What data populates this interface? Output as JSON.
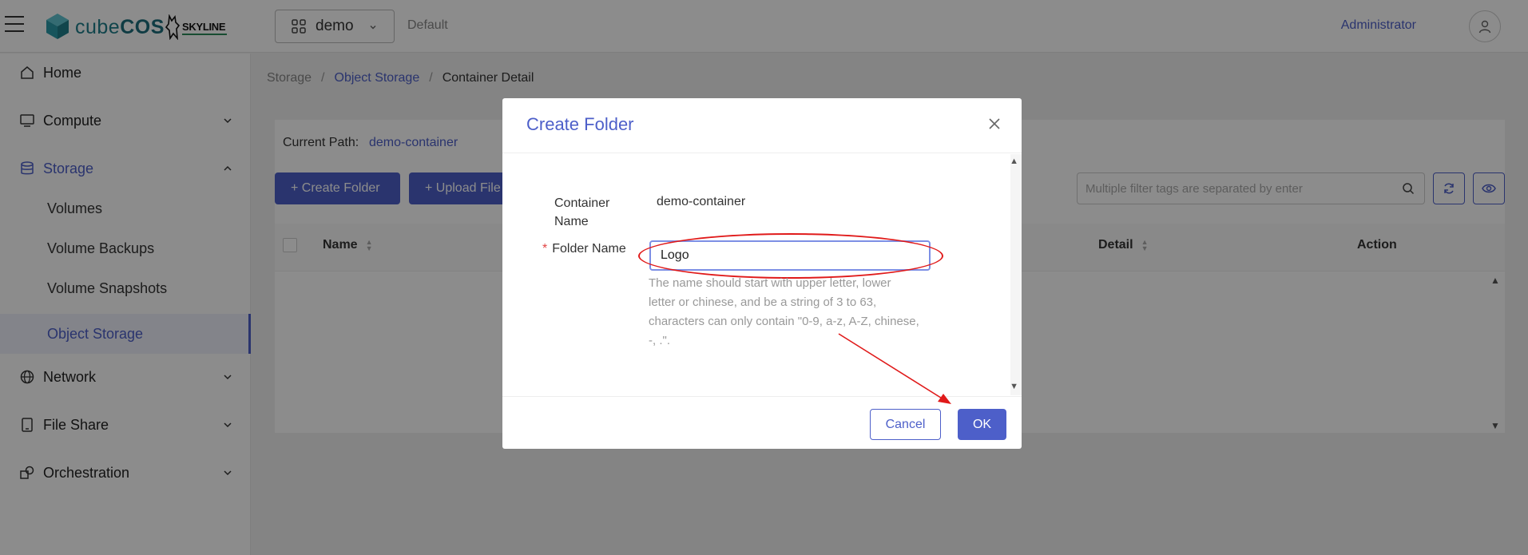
{
  "header": {
    "logo_text_prefix": "cube",
    "logo_text_suffix": "COS",
    "partner_logo": "SKYLINE",
    "project": "demo",
    "domain": "Default",
    "user": "Administrator"
  },
  "sidebar": {
    "items": [
      {
        "label": "Home",
        "icon": "home-icon"
      },
      {
        "label": "Compute",
        "icon": "monitor-icon"
      },
      {
        "label": "Storage",
        "icon": "database-icon"
      },
      {
        "label": "Network",
        "icon": "globe-icon"
      },
      {
        "label": "File Share",
        "icon": "tablet-icon"
      },
      {
        "label": "Orchestration",
        "icon": "shapes-icon"
      }
    ],
    "storage_sub": [
      "Volumes",
      "Volume Backups",
      "Volume Snapshots",
      "Object Storage"
    ]
  },
  "breadcrumb": {
    "root": "Storage",
    "parent": "Object Storage",
    "current": "Container Detail"
  },
  "main": {
    "current_path_label": "Current Path:",
    "current_path_value": "demo-container",
    "create_folder_btn": "+ Create Folder",
    "upload_file_btn": "+ Upload File",
    "search_placeholder": "Multiple filter tags are separated by enter",
    "columns": [
      "Name",
      "Detail",
      "Action"
    ]
  },
  "modal": {
    "title": "Create Folder",
    "container_name_label": "Container Name",
    "container_name_value": "demo-container",
    "folder_name_label": "Folder Name",
    "folder_name_value": "Logo",
    "help_text": "The name should start with upper letter, lower letter or chinese, and be a string of 3 to 63, characters can only contain \"0-9, a-z, A-Z, chinese, -, .\".",
    "cancel_label": "Cancel",
    "ok_label": "OK"
  },
  "colors": {
    "accent": "#4d5fc9",
    "annotation": "#e01a1a",
    "required": "#e24444"
  }
}
